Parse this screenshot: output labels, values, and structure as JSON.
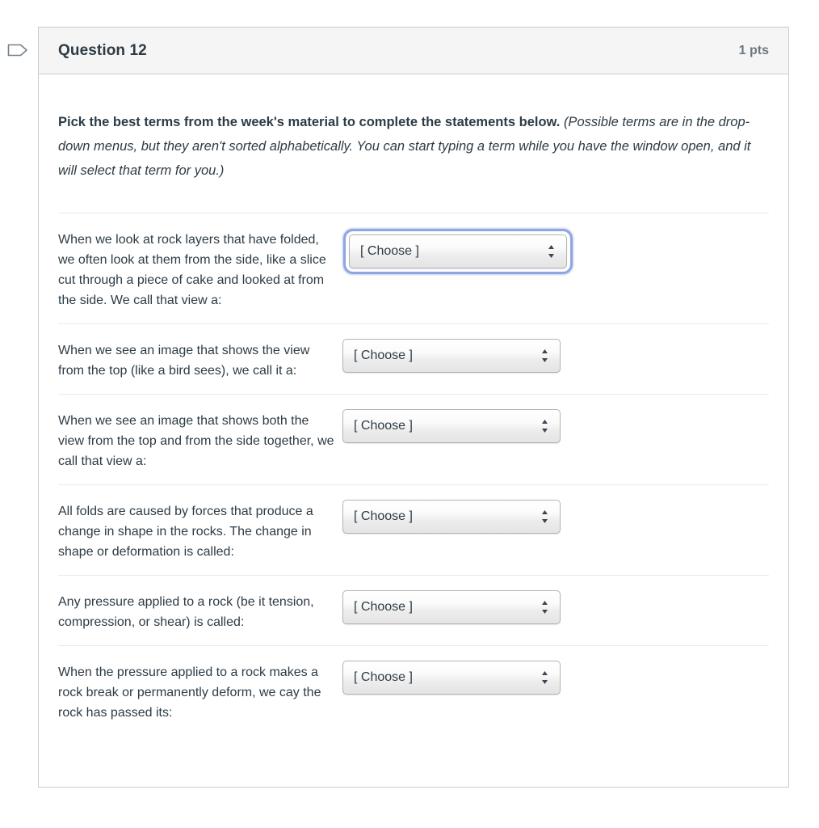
{
  "header": {
    "title": "Question 12",
    "points": "1 pts",
    "flag_icon": "flag-outline-icon"
  },
  "intro": {
    "lead": "Pick the best terms from the week's material to complete the statements below.",
    "note": "(Possible terms are in the drop-down menus, but they aren't sorted alphabetically. You can start typing a term while you have the window open, and it will select that term for you.)"
  },
  "select_placeholder": "[ Choose ]",
  "select_arrows_icon": "up-down-arrows-icon",
  "colors": {
    "card_border": "#c7cdd1",
    "header_bg": "#f5f5f5",
    "text": "#2d3b45",
    "points_text": "#6b7780",
    "divider": "#e8eaec",
    "focus_ring": "#8ea6e2",
    "flag_stroke": "#73818c"
  },
  "rows": [
    {
      "stem": "When we look at rock layers that have folded, we often look at them from the side, like a slice cut through a piece of cake and looked at from the side. We call that view a:",
      "value": "[ Choose ]",
      "focused": true
    },
    {
      "stem": "When we see an image that shows the view from the top (like a bird sees), we call it a:",
      "value": "[ Choose ]",
      "focused": false
    },
    {
      "stem": "When we see an image that shows both the view from the top and from the side together, we call that view a:",
      "value": "[ Choose ]",
      "focused": false
    },
    {
      "stem": "All folds are caused by forces that produce a change in shape in the rocks. The change in shape or deformation is called:",
      "value": "[ Choose ]",
      "focused": false
    },
    {
      "stem": "Any pressure applied to a rock (be it tension, compression, or shear) is called:",
      "value": "[ Choose ]",
      "focused": false
    },
    {
      "stem": "When the pressure applied to a rock makes a rock break or permanently deform, we cay the rock has passed its:",
      "value": "[ Choose ]",
      "focused": false
    }
  ]
}
